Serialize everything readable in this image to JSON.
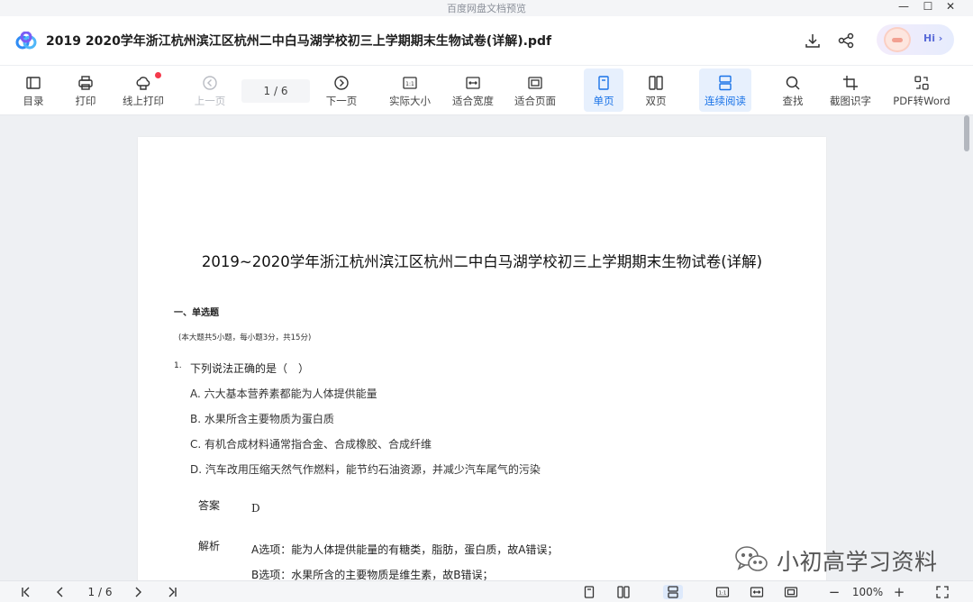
{
  "window": {
    "title": "百度网盘文档预览",
    "controls": {
      "minimize": "—",
      "maximize": "☐",
      "close": "✕"
    }
  },
  "header": {
    "doc_title": "2019  2020学年浙江杭州滨江区杭州二中白马湖学校初三上学期期末生物试卷(详解).pdf",
    "hi_label": "Hi ›"
  },
  "toolbar": {
    "catalog": "目录",
    "print": "打印",
    "online_print": "线上打印",
    "prev_page": "上一页",
    "page_indicator": "1 / 6",
    "next_page": "下一页",
    "actual_size": "实际大小",
    "fit_width": "适合宽度",
    "fit_page": "适合页面",
    "single_page": "单页",
    "double_page": "双页",
    "continuous": "连续阅读",
    "find": "查找",
    "ocr": "截图识字",
    "pdf_to_word": "PDF转Word"
  },
  "document": {
    "title": "2019~2020学年浙江杭州滨江区杭州二中白马湖学校初三上学期期末生物试卷(详解)",
    "section": "一、单选题",
    "section_note": "(本大题共5小题，每小题3分，共15分)",
    "question": {
      "number": "1.",
      "text": "下列说法正确的是（　）",
      "options": [
        "A. 六大基本营养素都能为人体提供能量",
        "B. 水果所含主要物质为蛋白质",
        "C. 有机合成材料通常指合金、合成橡胶、合成纤维",
        "D. 汽车改用压缩天然气作燃料，能节约石油资源，并减少汽车尾气的污染"
      ],
      "answer_label": "答案",
      "answer": "D",
      "explanation_label": "解析",
      "explanation": [
        "A选项：能为人体提供能量的有糖类，脂肪，蛋白质，故A错误；",
        "B选项：水果所含的主要物质是维生素，故B错误；"
      ]
    }
  },
  "watermark": {
    "wechat_text": "小初高学习资料"
  },
  "bottom_bar": {
    "page_indicator": "1 / 6",
    "zoom": "100%",
    "zoom_out": "−",
    "zoom_in": "+"
  },
  "colors": {
    "accent": "#1a73e8",
    "active_bg": "#e7f0fd",
    "notification_dot": "#f5394b"
  }
}
